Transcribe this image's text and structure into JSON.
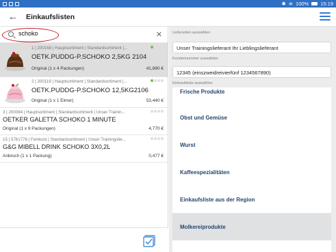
{
  "statusbar": {
    "right_text": "100%",
    "time": "15:19"
  },
  "appbar": {
    "title": "Einkaufslisten"
  },
  "search": {
    "value": "schoko"
  },
  "items": [
    {
      "meta": "1 | 200168 | Hauptsortiment | Standardsortiment |...",
      "name": "OETK.PUDDG-P.SCHOKO 2,5KG 2104",
      "pack": "Original (1 x 4 Packungen)",
      "price": "41,880 €"
    },
    {
      "meta": "2 | 200119 | Hauptsortiment | Standardsortiment |...",
      "name": "OETK.PUDDG-P.SCHOKO 12,5KG2106",
      "pack": "Original (1 x 1 Eimer)",
      "price": "53,440 €"
    },
    {
      "meta": "3 | 200084 | Hauptsortiment | Standardsortiment | Unser Trainin...",
      "name": "OETKER GALETTA SCHOKO 1 MINUTE",
      "pack": "Original (1 x 9 Packungen)",
      "price": "4,770 €"
    },
    {
      "meta": "15 | 5761776 | Feinkost | Standardsortiment | Unser Trainingslie...",
      "name": "G&G MIBELL DRINK SCHOKO 3X0,2L",
      "pack": "Anbruch (1 x 1 Packung)",
      "price": "0,477 €"
    }
  ],
  "right": {
    "supplier_label": "Lieferanten auswählen",
    "supplier_value": "Unser Trainingslieferant Ihr Lieblingslieferant",
    "customer_label": "Kundennummer auswählen",
    "customer_value": "12345 (einszweidreivierfünf 1234567890)",
    "list_label": "Einkaufsliste auswählen",
    "options": [
      "Frische Produkte",
      "Obst und Gemüse",
      "Wurst",
      "Kaffeespezialitäten",
      "Einkaufsliste aus der Region",
      "Molkereiprodukte"
    ]
  },
  "colors": {
    "accent": "#2f7ad6",
    "statusbar": "#2f6fc4",
    "highlight": "#dfe1e3",
    "option_text": "#26466d",
    "search_circle": "#c0141b",
    "dot_active": "#6cc24a",
    "dot_inactive": "#e9d6ea"
  },
  "icons": {
    "back": "arrow-left-icon",
    "menu": "hamburger-menu-icon",
    "search": "search-icon",
    "clear": "close-icon",
    "check": "checklist-icon"
  }
}
